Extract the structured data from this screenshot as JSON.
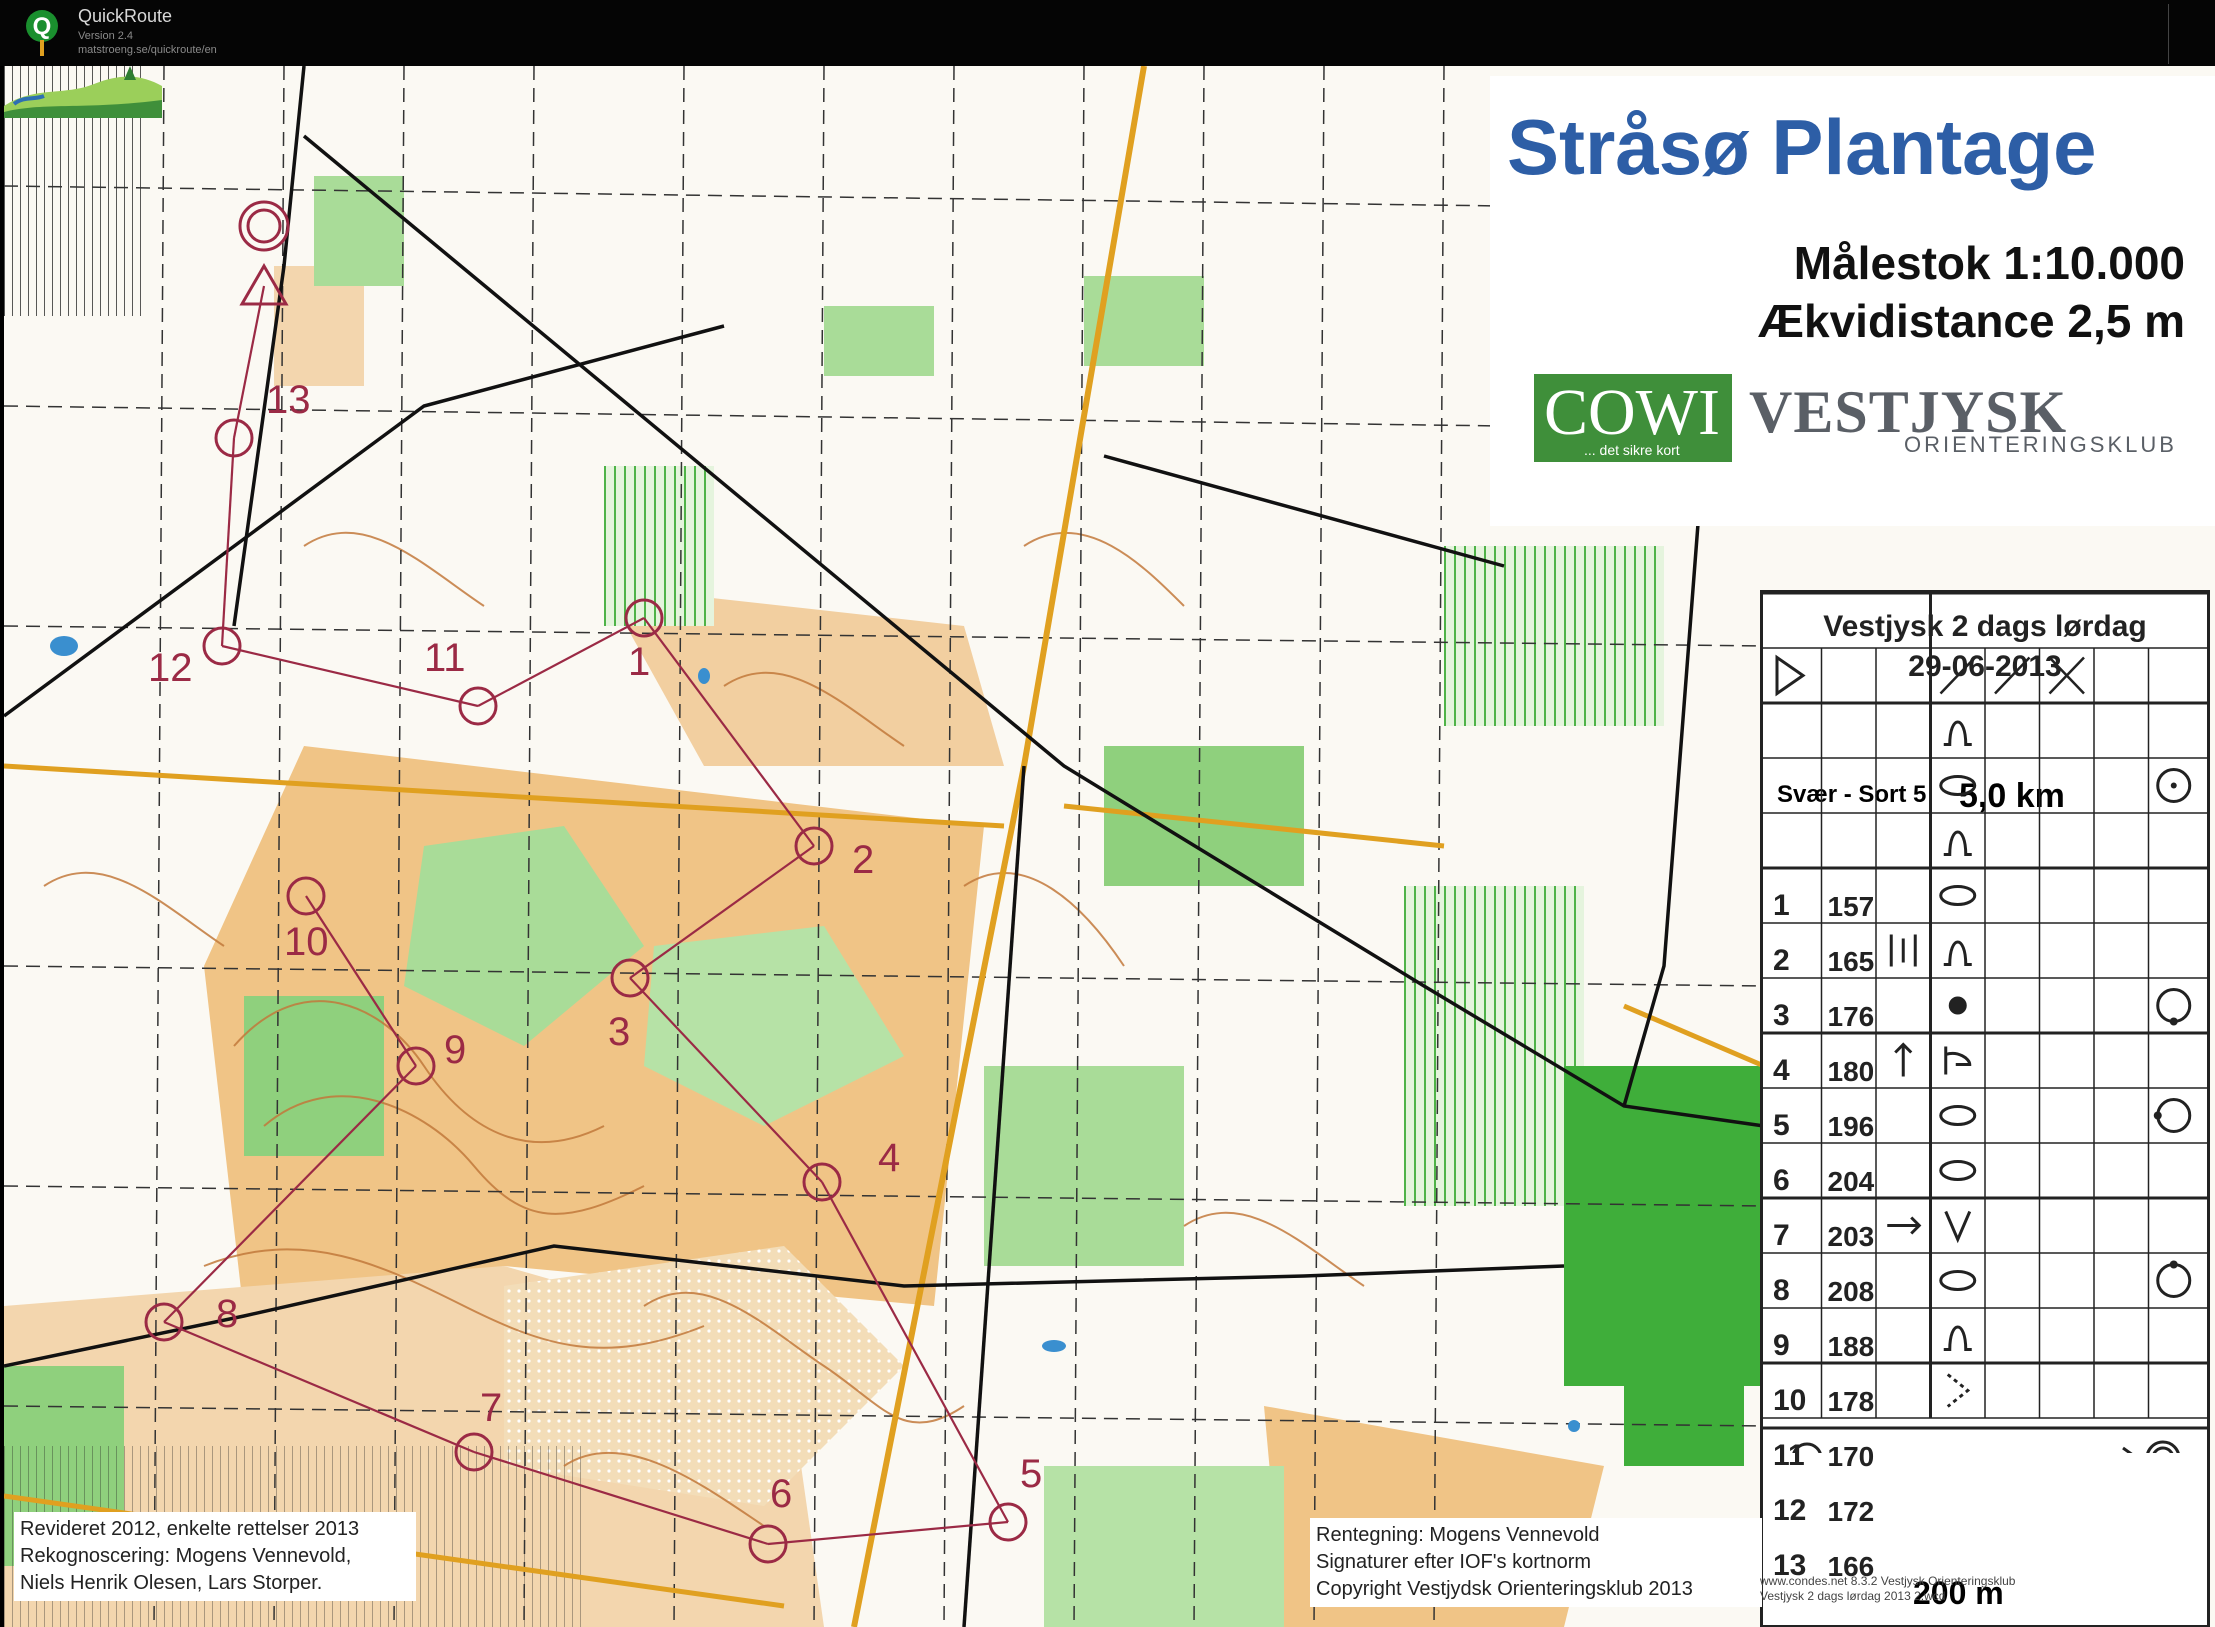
{
  "app": {
    "name": "QuickRoute",
    "version": "Version 2.4",
    "url": "matstroeng.se/quickroute/en"
  },
  "map": {
    "title": "Stråsø Plantage",
    "scale": "Målestok 1:10.000",
    "equidistance": "Ækvidistance 2,5 m",
    "sponsor_main": "COWI",
    "sponsor_sub": "... det sikre kort",
    "club_name": "VESTJYSK",
    "club_sub": "ORIENTERINGSKLUB",
    "credits_left": [
      "Revideret 2012, enkelte rettelser 2013",
      "Rekognoscering: Mogens Vennevold,",
      "Niels Henrik Olesen, Lars Storper."
    ],
    "credits_right": [
      "Rentegning: Mogens Vennevold",
      "Signaturer efter IOF's kortnorm",
      "Copyright Vestjydsk Orienteringsklub 2013"
    ],
    "footnote": [
      "www.condes.net 8.3.2 Vestjysk Orienteringsklub",
      "Vestjysk 2 dags lørdag 2013 2.wcd"
    ],
    "colors": {
      "open": "#f0c486",
      "forest_green": "#8fd07d",
      "dark_green": "#3fae3a",
      "contour": "#c2793b",
      "course": "#9b2a45",
      "title_blue": "#2d5ea6"
    }
  },
  "description": {
    "event": "Vestjysk 2 dags lørdag",
    "date": "29-06-2013",
    "class": "Svær - Sort 5",
    "length": "5,0 km",
    "scale_bar": "200 m",
    "controls": [
      {
        "num": "1",
        "code": "157",
        "col_d": "",
        "feature": "knoll",
        "appendix": ""
      },
      {
        "num": "2",
        "code": "165",
        "col_d": "",
        "feature": "depression",
        "appendix": "circle"
      },
      {
        "num": "3",
        "code": "176",
        "col_d": "",
        "feature": "knoll",
        "appendix": ""
      },
      {
        "num": "4",
        "code": "180",
        "col_d": "",
        "feature": "depression",
        "appendix": ""
      },
      {
        "num": "5",
        "code": "196",
        "col_d": "between",
        "feature": "knoll",
        "appendix": ""
      },
      {
        "num": "6",
        "code": "204",
        "col_d": "",
        "feature": "dot",
        "appendix": "circle-dot-bottom"
      },
      {
        "num": "7",
        "code": "203",
        "col_d": "arrow-up",
        "feature": "spur",
        "appendix": ""
      },
      {
        "num": "8",
        "code": "208",
        "col_d": "",
        "feature": "depression",
        "appendix": "circle-dot-left"
      },
      {
        "num": "9",
        "code": "188",
        "col_d": "",
        "feature": "depression",
        "appendix": ""
      },
      {
        "num": "10",
        "code": "178",
        "col_d": "arrow-right",
        "feature": "gully",
        "appendix": ""
      },
      {
        "num": "11",
        "code": "170",
        "col_d": "",
        "feature": "depression",
        "appendix": "circle-dot-top"
      },
      {
        "num": "12",
        "code": "172",
        "col_d": "",
        "feature": "knoll",
        "appendix": ""
      },
      {
        "num": "13",
        "code": "166",
        "col_d": "",
        "feature": "finish-arrow",
        "appendix": ""
      }
    ]
  },
  "course_labels": [
    "1",
    "2",
    "3",
    "4",
    "5",
    "6",
    "7",
    "8",
    "9",
    "10",
    "11",
    "12",
    "13"
  ]
}
